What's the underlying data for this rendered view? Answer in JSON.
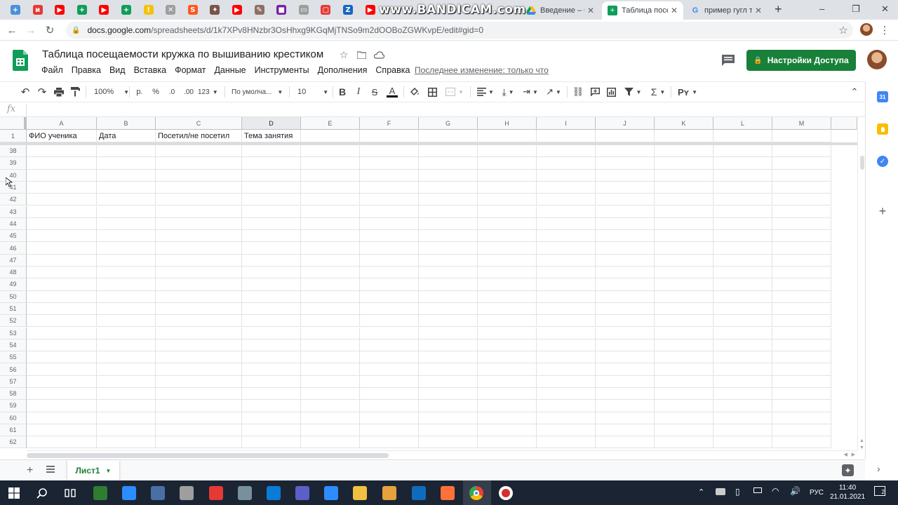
{
  "browser": {
    "pinned_tabs": [
      {
        "icon": "gdrive-plus-icon",
        "color": "#4a90d9",
        "glyph": "+"
      },
      {
        "icon": "script-icon",
        "color": "#e53935",
        "glyph": "и"
      },
      {
        "icon": "youtube-icon",
        "color": "#ff0000",
        "glyph": "▶"
      },
      {
        "icon": "sheets-icon",
        "color": "#0f9d58",
        "glyph": "+"
      },
      {
        "icon": "youtube-icon",
        "color": "#ff0000",
        "glyph": "▶"
      },
      {
        "icon": "sheets-icon",
        "color": "#0f9d58",
        "glyph": "+"
      },
      {
        "icon": "keep-icon",
        "color": "#f4c20d",
        "glyph": "!"
      },
      {
        "icon": "tools-icon",
        "color": "#9e9e9e",
        "glyph": "✕"
      },
      {
        "icon": "s-icon",
        "color": "#ff5722",
        "glyph": "S"
      },
      {
        "icon": "compass-icon",
        "color": "#795548",
        "glyph": "✦"
      },
      {
        "icon": "youtube-icon",
        "color": "#ff0000",
        "glyph": "▶"
      },
      {
        "icon": "pen-icon",
        "color": "#8d6e63",
        "glyph": "✎"
      },
      {
        "icon": "square-icon",
        "color": "#7b1fa2",
        "glyph": "■"
      },
      {
        "icon": "monitor-icon",
        "color": "#9e9e9e",
        "glyph": "▭"
      },
      {
        "icon": "youtube-icon",
        "color": "#e53935",
        "glyph": "▢"
      },
      {
        "icon": "z-icon",
        "color": "#1565c0",
        "glyph": "Z"
      },
      {
        "icon": "youtube-icon",
        "color": "#ff0000",
        "glyph": "▶"
      }
    ],
    "watermark": "www.BANDICAM.com",
    "tabs": [
      {
        "label": "Введение – Go",
        "icon": "drive-icon"
      },
      {
        "label": "Таблица посе",
        "icon": "sheets-icon",
        "active": true
      },
      {
        "label": "пример гугл та",
        "icon": "google-icon"
      }
    ],
    "new_tab": "+",
    "url_host": "docs.google.com",
    "url_path": "/spreadsheets/d/1k7XPv8HNzbr3OsHhxg9KGqMjTNSo9m2dOOBoZGWKvpE/edit#gid=0"
  },
  "sheets": {
    "title": "Таблица посещаемости кружка по вышиванию крестиком",
    "menu": [
      "Файл",
      "Правка",
      "Вид",
      "Вставка",
      "Формат",
      "Данные",
      "Инструменты",
      "Дополнения",
      "Справка"
    ],
    "last_edit": "Последнее изменение: только что",
    "share_label": "Настройки Доступа",
    "toolbar": {
      "zoom": "100%",
      "currency": "р.",
      "percent": "%",
      "dec_less": ".0",
      "dec_more": ".00",
      "format": "123",
      "font": "По умолча...",
      "font_size": "10"
    },
    "fx": "fx",
    "columns": [
      "A",
      "B",
      "C",
      "D",
      "E",
      "F",
      "G",
      "H",
      "I",
      "J",
      "K",
      "L",
      "M"
    ],
    "selected_column": "D",
    "header_row": {
      "number": "1",
      "cells": [
        "ФИО ученика",
        "Дата",
        "Посетил/не посетил",
        "Тема занятия"
      ]
    },
    "visible_rows": [
      "38",
      "39",
      "40",
      "41",
      "42",
      "43",
      "44",
      "45",
      "46",
      "47",
      "48",
      "49",
      "50",
      "51",
      "52",
      "53",
      "54",
      "55",
      "56",
      "57",
      "58",
      "59",
      "60",
      "61",
      "62"
    ],
    "sheet_tab": "Лист1"
  },
  "taskbar": {
    "apps": [
      {
        "icon": "windows-start-icon",
        "color": "#ffffff"
      },
      {
        "icon": "search-icon",
        "color": "#ffffff"
      },
      {
        "icon": "task-view-icon",
        "color": "#ffffff"
      },
      {
        "icon": "chart-app-icon",
        "color": "#2e7d32"
      },
      {
        "icon": "zoom-app-icon",
        "color": "#2d8cff"
      },
      {
        "icon": "calculator-icon",
        "color": "#4a6fa5"
      },
      {
        "icon": "paint-icon",
        "color": "#9e9e9e"
      },
      {
        "icon": "acrobat-icon",
        "color": "#e53935"
      },
      {
        "icon": "notes-icon",
        "color": "#78909c"
      },
      {
        "icon": "edge-icon",
        "color": "#0a7cd8"
      },
      {
        "icon": "teams-icon",
        "color": "#5b5fc7"
      },
      {
        "icon": "zoom-icon",
        "color": "#2d8cff"
      },
      {
        "icon": "explorer-icon",
        "color": "#f0c040"
      },
      {
        "icon": "outlook-icon",
        "color": "#e6a23c"
      },
      {
        "icon": "lync-icon",
        "color": "#0f6cbd"
      },
      {
        "icon": "firefox-icon",
        "color": "#ff7139"
      },
      {
        "icon": "chrome-icon",
        "color": "#34a853"
      },
      {
        "icon": "record-icon",
        "color": "#d32f2f"
      }
    ],
    "language": "РУС",
    "time": "11:40",
    "date": "21.01.2021",
    "notification_count": "2"
  }
}
